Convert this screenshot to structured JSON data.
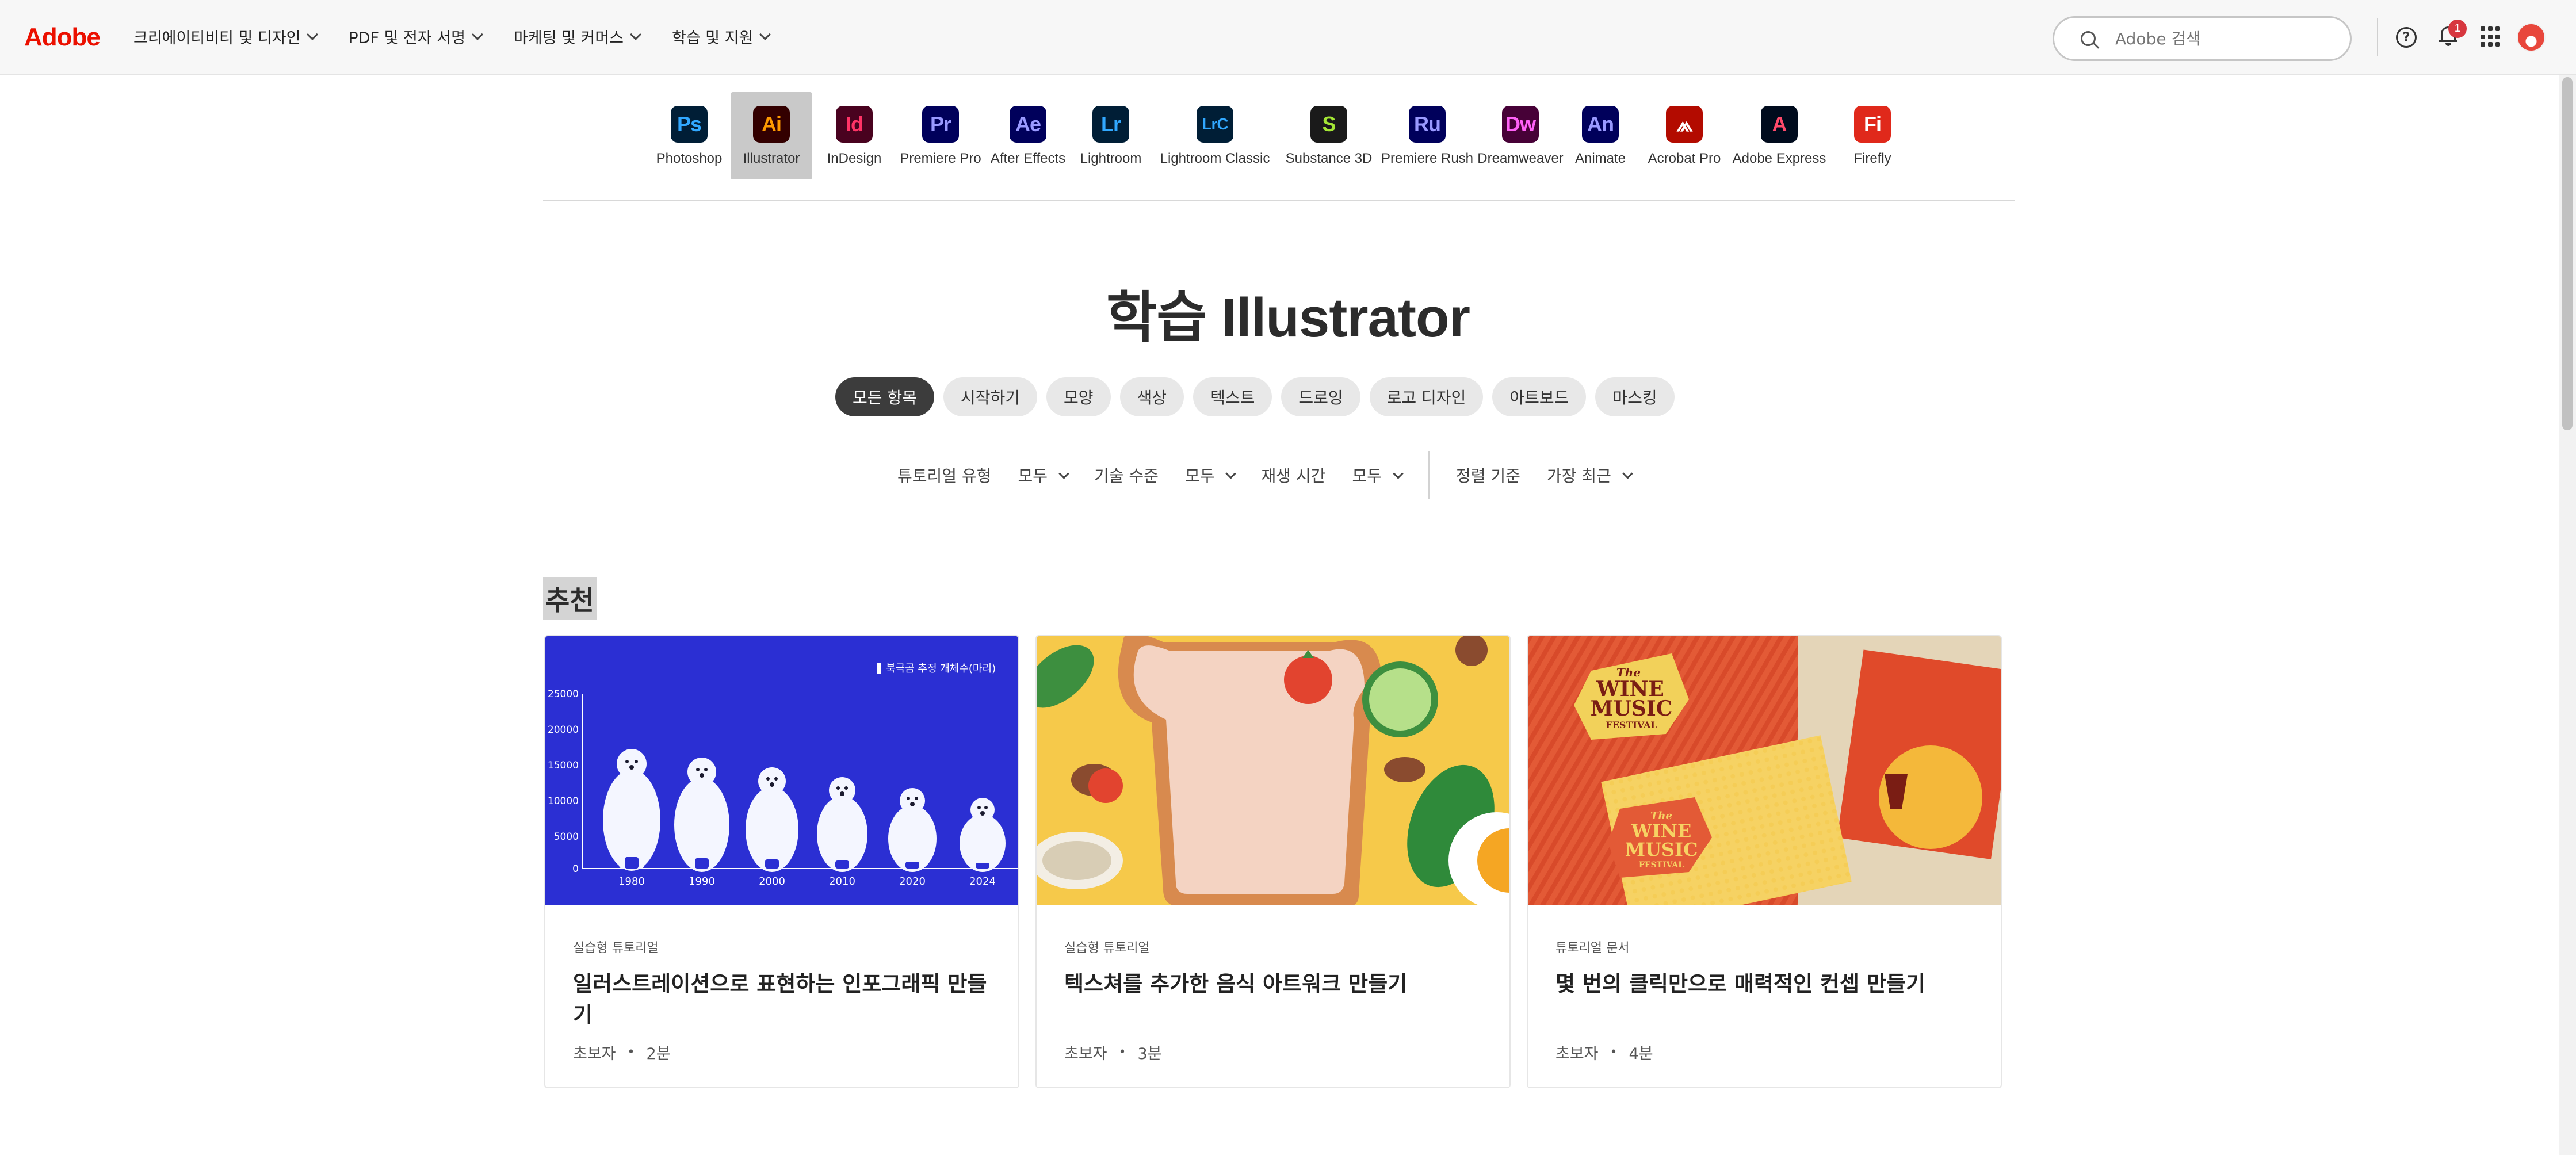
{
  "header": {
    "logo": "Adobe",
    "nav": [
      {
        "label": "크리에이티비티 및 디자인"
      },
      {
        "label": "PDF 및 전자 서명"
      },
      {
        "label": "마케팅 및 커머스"
      },
      {
        "label": "학습 및 지원"
      }
    ],
    "search_placeholder": "Adobe 검색",
    "help_glyph": "?",
    "notification_count": "1"
  },
  "products": [
    {
      "abbr": "Ps",
      "label": "Photoshop",
      "bg": "#001e36",
      "fg": "#31a8ff"
    },
    {
      "abbr": "Ai",
      "label": "Illustrator",
      "bg": "#330000",
      "fg": "#ff9a00",
      "active": true
    },
    {
      "abbr": "Id",
      "label": "InDesign",
      "bg": "#49021f",
      "fg": "#ff3366"
    },
    {
      "abbr": "Pr",
      "label": "Premiere Pro",
      "bg": "#00005b",
      "fg": "#9999ff"
    },
    {
      "abbr": "Ae",
      "label": "After Effects",
      "bg": "#00005b",
      "fg": "#9999ff"
    },
    {
      "abbr": "Lr",
      "label": "Lightroom",
      "bg": "#001e36",
      "fg": "#31a8ff"
    },
    {
      "abbr": "LrC",
      "label": "Lightroom Classic",
      "bg": "#001e36",
      "fg": "#31a8ff"
    },
    {
      "abbr": "S",
      "label": "Substance 3D",
      "bg": "#1a1a1a",
      "fg": "#a3e635"
    },
    {
      "abbr": "Ru",
      "label": "Premiere Rush",
      "bg": "#00005b",
      "fg": "#9999ff"
    },
    {
      "abbr": "Dw",
      "label": "Dreamweaver",
      "bg": "#470137",
      "fg": "#ff61f6"
    },
    {
      "abbr": "An",
      "label": "Animate",
      "bg": "#00005b",
      "fg": "#9999ff"
    },
    {
      "abbr": "⩕",
      "label": "Acrobat Pro",
      "bg": "#b30b00",
      "fg": "#ffffff"
    },
    {
      "abbr": "A",
      "label": "Adobe Express",
      "bg": "#000b1d",
      "fg": "#ff4a6b"
    },
    {
      "abbr": "Fi",
      "label": "Firefly",
      "bg": "#e0291b",
      "fg": "#ffffff"
    }
  ],
  "page_title": "학습 Illustrator",
  "chips": [
    "모든 항목",
    "시작하기",
    "모양",
    "색상",
    "텍스트",
    "드로잉",
    "로고 디자인",
    "아트보드",
    "마스킹"
  ],
  "filters": {
    "tutorial_type_label": "튜토리얼 유형",
    "tutorial_type_value": "모두",
    "skill_label": "기술 수준",
    "skill_value": "모두",
    "duration_label": "재생 시간",
    "duration_value": "모두",
    "sort_label": "정렬 기준",
    "sort_value": "가장 최근"
  },
  "section_title": "추천",
  "cards": [
    {
      "type": "실습형 튜토리얼",
      "title": "일러스트레이션으로 표현하는 인포그래픽 만들기",
      "level": "초보자",
      "duration": "2분",
      "image": {
        "legend": "북극곰 추정 개체수(마리)",
        "y_ticks": [
          "25000",
          "20000",
          "15000",
          "10000",
          "5000",
          "0"
        ],
        "x_ticks": [
          "1980",
          "1990",
          "2000",
          "2010",
          "2020",
          "2024"
        ]
      }
    },
    {
      "type": "실습형 튜토리얼",
      "title": "텍스쳐를 추가한 음식 아트워크 만들기",
      "level": "초보자",
      "duration": "3분"
    },
    {
      "type": "튜토리얼 문서",
      "title": "몇 번의 클릭만으로 매력적인 컨셉 만들기",
      "level": "초보자",
      "duration": "4분",
      "image": {
        "poster_small": "The",
        "poster_line1": "WINE",
        "poster_line2": "MUSIC",
        "poster_line3": "FESTIVAL"
      }
    }
  ],
  "colors": {
    "adobe_red": "#eb1000",
    "chip_active": "#3c3c3c",
    "chart_blue": "#2b2fd3"
  }
}
